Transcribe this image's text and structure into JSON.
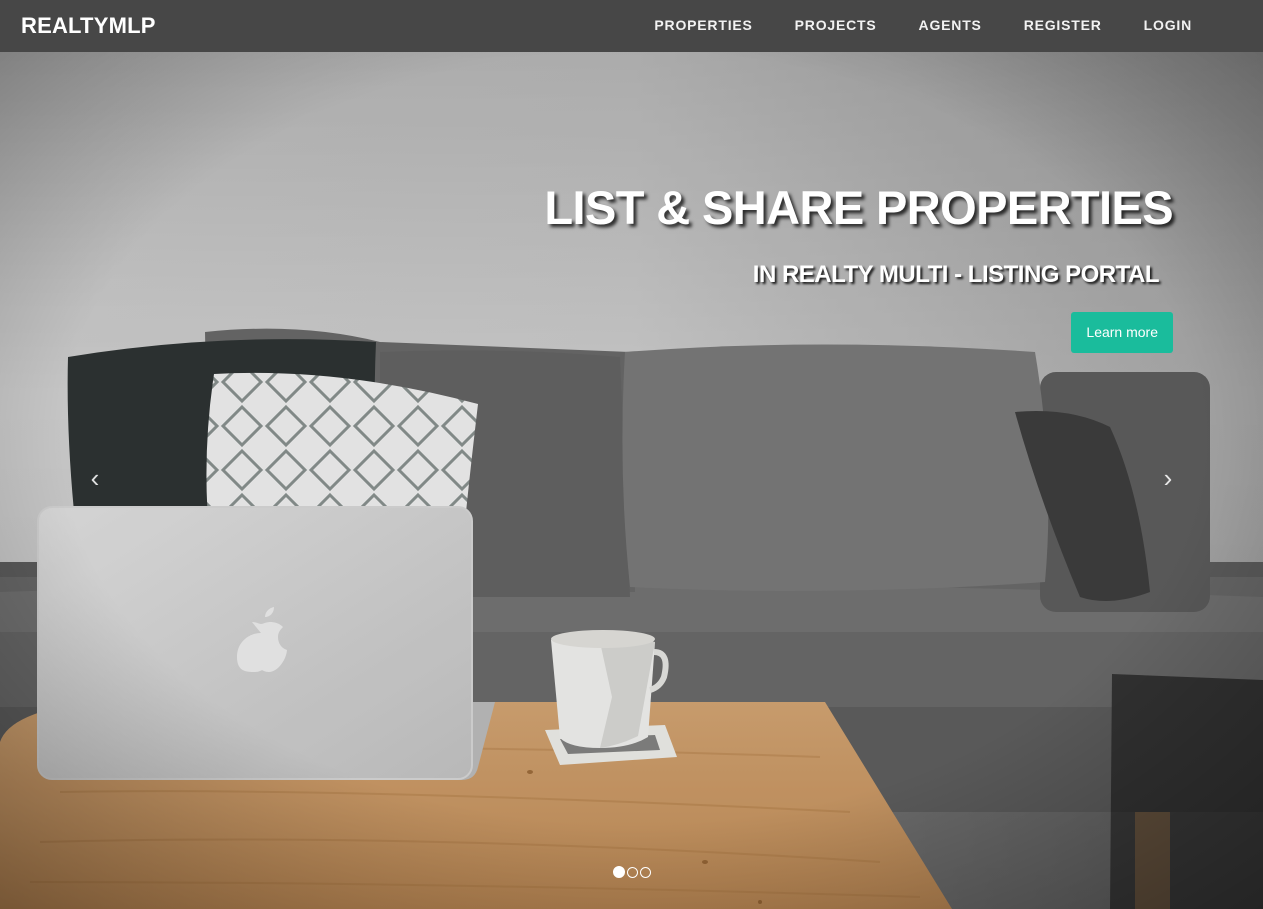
{
  "brand": "REALTYMLP",
  "nav": [
    "PROPERTIES",
    "PROJECTS",
    "AGENTS",
    "REGISTER",
    "LOGIN"
  ],
  "hero": {
    "title": "LIST & SHARE PROPERTIES",
    "subtitle": "IN REALTY MULTI - LISTING PORTAL",
    "cta": "Learn more",
    "prev_glyph": "‹",
    "next_glyph": "›",
    "slide_count": 3,
    "active_slide": 1
  },
  "colors": {
    "navbar": "#474747",
    "accent": "#1abc9c"
  },
  "icons": [
    "chevron-left-icon",
    "chevron-right-icon",
    "apple-logo-icon"
  ]
}
